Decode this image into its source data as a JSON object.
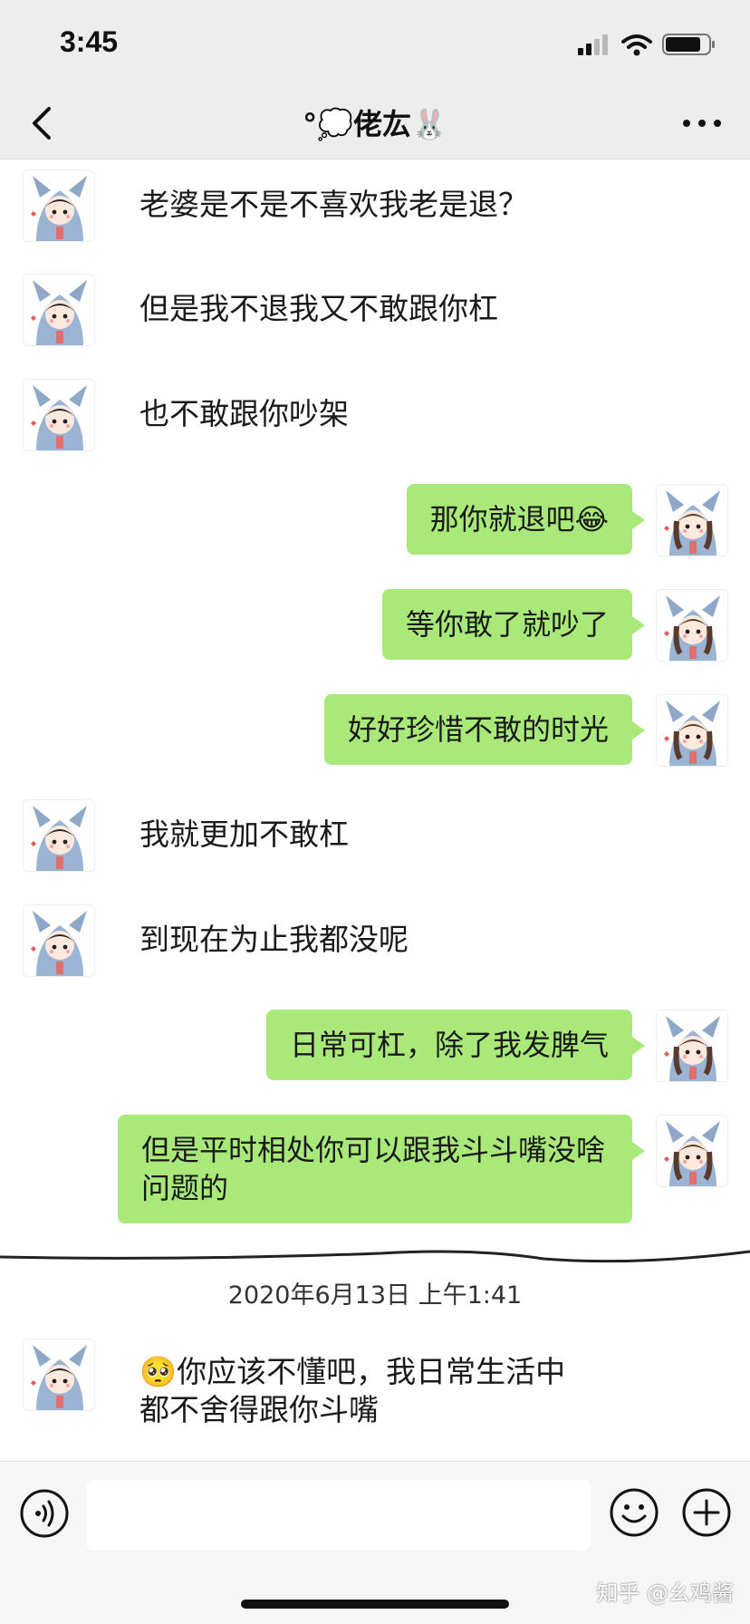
{
  "status_bar": {
    "time": "3:45"
  },
  "header": {
    "title": "°💭佬厷🐰",
    "back_icon": "chevron-left-icon",
    "more_icon": "ellipsis-icon"
  },
  "messages": [
    {
      "side": "left",
      "text": "老婆是不是不喜欢我老是退？"
    },
    {
      "side": "left",
      "text": "但是我不退我又不敢跟你杠"
    },
    {
      "side": "left",
      "text": "也不敢跟你吵架"
    },
    {
      "side": "right",
      "text": "那你就退吧😂"
    },
    {
      "side": "right",
      "text": "等你敢了就吵了"
    },
    {
      "side": "right",
      "text": "好好珍惜不敢的时光"
    },
    {
      "side": "left",
      "text": "我就更加不敢杠"
    },
    {
      "side": "left",
      "text": "到现在为止我都没呢"
    },
    {
      "side": "right",
      "text": "日常可杠，除了我发脾气"
    },
    {
      "side": "right",
      "text": "但是平时相处你可以跟我斗斗嘴没啥问题的"
    },
    {
      "side": "left",
      "text": "🥺你应该不懂吧，我日常生活中都不舍得跟你斗嘴"
    }
  ],
  "timestamp": "2020年6月13日 上午1:41",
  "input_bar": {
    "placeholder": "",
    "value": ""
  },
  "watermark": "知乎 @幺鸡酱",
  "colors": {
    "bubble_green": "#a9e97a",
    "header_bg": "#ededed"
  }
}
